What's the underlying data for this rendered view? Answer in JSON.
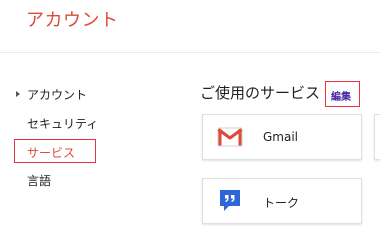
{
  "header": {
    "title": "アカウント"
  },
  "sidebar": {
    "items": [
      {
        "label": "アカウント"
      },
      {
        "label": "セキュリティ"
      },
      {
        "label": "サービス"
      },
      {
        "label": "言語"
      }
    ]
  },
  "main": {
    "section_title": "ご使用のサービス",
    "edit_label": "編集",
    "services": [
      {
        "label": "Gmail",
        "icon": "gmail-icon"
      },
      {
        "label": "トーク",
        "icon": "talk-icon"
      }
    ]
  },
  "colors": {
    "brand_red": "#dd4b39",
    "highlight_red": "#e8353f",
    "edit_link": "#4d2aa8",
    "talk_blue": "#2e66d8"
  }
}
